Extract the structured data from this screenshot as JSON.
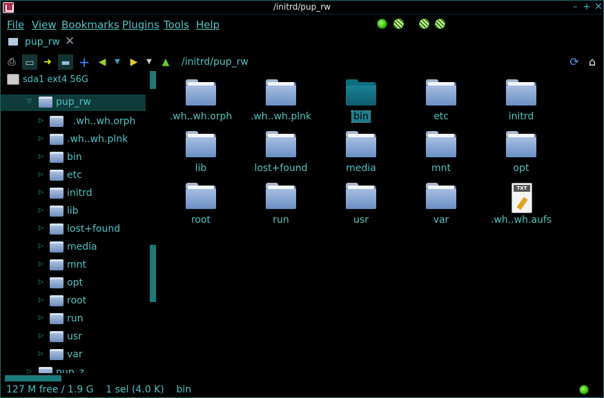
{
  "window": {
    "title": "/initrd/pup_rw"
  },
  "menu": [
    "File",
    "View",
    "Bookmarks",
    "Plugins",
    "Tools",
    "Help"
  ],
  "tab": {
    "label": "pup_rw",
    "close": "✕"
  },
  "toolbar": {
    "path": "/initrd/pup_rw",
    "icons": [
      "usb-drive-icon",
      "drive-icon",
      "go-arrow-icon",
      "folder-icon",
      "add-icon",
      "back-icon",
      "back-menu-icon",
      "forward-icon",
      "forward-menu-icon",
      "up-icon",
      "refresh-icon",
      "home-icon"
    ]
  },
  "sidebar": {
    "device": "sda1 ext4 56G",
    "root": "pup_rw",
    "items": [
      "  .wh..wh.orph",
      ".wh..wh.plnk",
      "bin",
      "etc",
      "initrd",
      "lib",
      "lost+found",
      "media",
      "mnt",
      "opt",
      "root",
      "run",
      "usr",
      "var"
    ],
    "partial_item": "pup_z"
  },
  "files": [
    {
      "name": ".wh..wh.orph",
      "type": "folder"
    },
    {
      "name": ".wh..wh.plnk",
      "type": "folder"
    },
    {
      "name": "bin",
      "type": "folder",
      "selected": true
    },
    {
      "name": "etc",
      "type": "folder"
    },
    {
      "name": "initrd",
      "type": "folder"
    },
    {
      "name": "lib",
      "type": "folder"
    },
    {
      "name": "lost+found",
      "type": "folder"
    },
    {
      "name": "media",
      "type": "folder"
    },
    {
      "name": "mnt",
      "type": "folder"
    },
    {
      "name": "opt",
      "type": "folder"
    },
    {
      "name": "root",
      "type": "folder"
    },
    {
      "name": "run",
      "type": "folder"
    },
    {
      "name": "usr",
      "type": "folder"
    },
    {
      "name": "var",
      "type": "folder"
    },
    {
      "name": ".wh..wh.aufs",
      "type": "text",
      "badge": "TXT"
    }
  ],
  "status": {
    "text": "127 M free / 1.9 G    1 sel (4.0 K)    bin"
  },
  "colors": {
    "accent": "#4fc3c3",
    "selection": "#0f3b3b",
    "scrollbar": "#1a7a7a"
  }
}
